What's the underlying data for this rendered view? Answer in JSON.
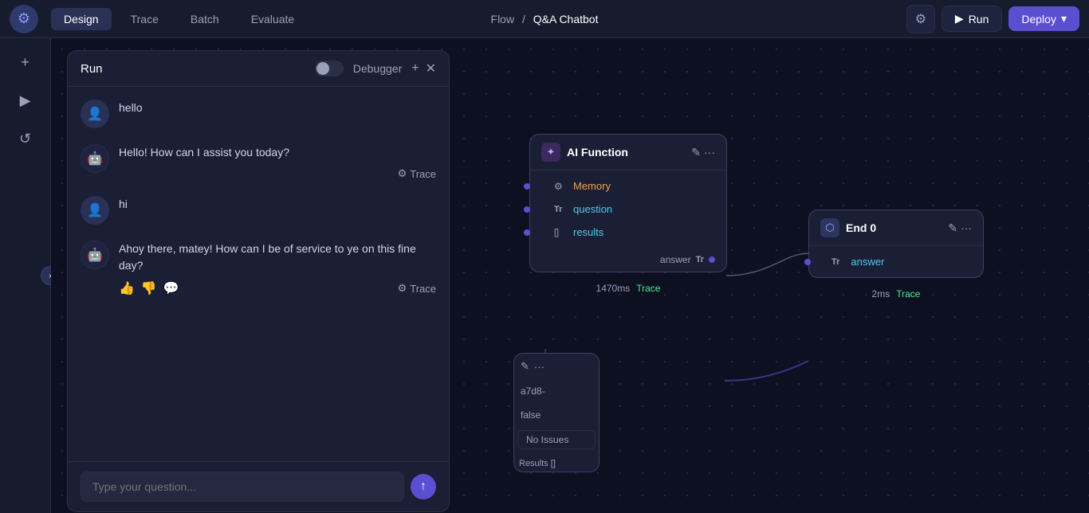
{
  "topnav": {
    "logo_icon": "⚙",
    "tabs": [
      {
        "label": "Design",
        "active": true
      },
      {
        "label": "Trace",
        "active": false
      },
      {
        "label": "Batch",
        "active": false
      },
      {
        "label": "Evaluate",
        "active": false
      }
    ],
    "breadcrumb": {
      "flow": "Flow",
      "slash": "/",
      "name": "Q&A Chatbot"
    },
    "gear_icon": "⚙",
    "run_icon": "▶",
    "run_label": "Run",
    "deploy_label": "Deploy",
    "deploy_arrow": "▾"
  },
  "sidebar": {
    "icons": [
      {
        "name": "plus-icon",
        "symbol": "+"
      },
      {
        "name": "play-icon",
        "symbol": "▶"
      },
      {
        "name": "history-icon",
        "symbol": "↺"
      }
    ]
  },
  "chat_panel": {
    "title": "Run",
    "debugger": "Debugger",
    "plus_icon": "+",
    "close_icon": "✕",
    "messages": [
      {
        "role": "user",
        "text": "hello",
        "avatar": "👤"
      },
      {
        "role": "bot",
        "text": "Hello! How can I assist you today?",
        "avatar": "🤖",
        "show_trace": true,
        "trace_label": "Trace"
      },
      {
        "role": "user",
        "text": "hi",
        "avatar": "👤"
      },
      {
        "role": "bot",
        "text": "Ahoy there, matey! How can I be of service to ye on this fine day?",
        "avatar": "🤖",
        "show_trace": true,
        "trace_label": "Trace",
        "show_feedback": true
      }
    ],
    "input_placeholder": "Type your question...",
    "send_icon": "↑"
  },
  "ai_function_node": {
    "title": "AI Function",
    "icon": "✦",
    "edit_icon": "✎",
    "more_icon": "•••",
    "params": [
      {
        "type": "memory",
        "icon": "⚙",
        "name": "Memory"
      },
      {
        "type": "text",
        "icon": "Tr",
        "name": "question"
      },
      {
        "type": "list",
        "icon": "[]",
        "name": "results"
      }
    ],
    "output_label": "answer",
    "output_icon": "Tr",
    "timing": "1470ms",
    "trace_label": "Trace"
  },
  "end_node": {
    "title": "End 0",
    "icon": "⬡",
    "edit_icon": "✎",
    "more_icon": "•••",
    "params": [
      {
        "type": "text",
        "icon": "Tr",
        "name": "answer"
      }
    ],
    "timing": "2ms",
    "trace_label": "Trace"
  },
  "partial_node": {
    "id_label": "a7d8-",
    "false_label": "false",
    "edit_icon": "✎",
    "more_icon": "•••",
    "no_issues": "No Issues"
  },
  "zoom_controls": {
    "plus": "+",
    "minus": "−",
    "fit": "⊞"
  }
}
